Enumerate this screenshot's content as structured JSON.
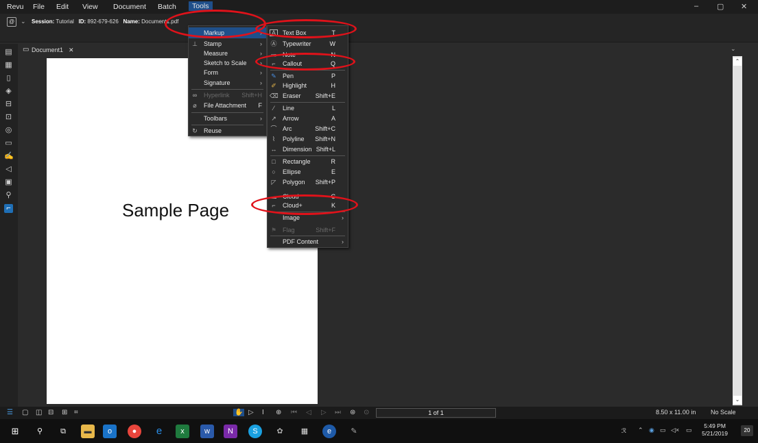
{
  "menubar": {
    "items": [
      "Revu",
      "File",
      "Edit",
      "View",
      "Document",
      "Batch",
      "Tools"
    ],
    "window_controls": [
      "–",
      "▢",
      "✕"
    ]
  },
  "session": {
    "label_session": "Session:",
    "session_value": "Tutorial",
    "label_id": "ID:",
    "id_value": "892-679-626",
    "label_name": "Name:",
    "name_value": "Document1.pdf"
  },
  "tab": {
    "label": "Document1",
    "close": "✕"
  },
  "page": {
    "text": "Sample Page"
  },
  "tools_menu": {
    "items": [
      {
        "label": "Markup",
        "shortcut": "",
        "arrow": "›",
        "state": "highlight"
      },
      {
        "label": "Stamp",
        "shortcut": "",
        "arrow": "›",
        "state": "normal"
      },
      {
        "label": "Measure",
        "shortcut": "",
        "arrow": "›",
        "state": "normal"
      },
      {
        "label": "Sketch to Scale",
        "shortcut": "",
        "arrow": "›",
        "state": "normal"
      },
      {
        "label": "Form",
        "shortcut": "",
        "arrow": "›",
        "state": "normal"
      },
      {
        "label": "Signature",
        "shortcut": "",
        "arrow": "›",
        "state": "normal"
      },
      {
        "label": "Hyperlink",
        "shortcut": "Shift+H",
        "arrow": "",
        "state": "disabled"
      },
      {
        "label": "File Attachment",
        "shortcut": "F",
        "arrow": "",
        "state": "normal"
      },
      {
        "label": "Toolbars",
        "shortcut": "",
        "arrow": "›",
        "state": "normal"
      },
      {
        "label": "Reuse",
        "shortcut": "",
        "arrow": "",
        "state": "normal"
      }
    ]
  },
  "markup_menu": {
    "items": [
      {
        "label": "Text Box",
        "shortcut": "T",
        "icon": "A"
      },
      {
        "label": "Typewriter",
        "shortcut": "W",
        "icon": "Ⓐ"
      },
      {
        "label": "Note",
        "shortcut": "N",
        "icon": "▭"
      },
      {
        "label": "Callout",
        "shortcut": "Q",
        "icon": "⌐"
      },
      {
        "label": "Pen",
        "shortcut": "P",
        "icon": "✎"
      },
      {
        "label": "Highlight",
        "shortcut": "H",
        "icon": "✐"
      },
      {
        "label": "Eraser",
        "shortcut": "Shift+E",
        "icon": "⌫"
      },
      {
        "label": "Line",
        "shortcut": "L",
        "icon": "⁄"
      },
      {
        "label": "Arrow",
        "shortcut": "A",
        "icon": "↗"
      },
      {
        "label": "Arc",
        "shortcut": "Shift+C",
        "icon": "⌒"
      },
      {
        "label": "Polyline",
        "shortcut": "Shift+N",
        "icon": "⌇"
      },
      {
        "label": "Dimension",
        "shortcut": "Shift+L",
        "icon": "↔"
      },
      {
        "label": "Rectangle",
        "shortcut": "R",
        "icon": "□"
      },
      {
        "label": "Ellipse",
        "shortcut": "E",
        "icon": "○"
      },
      {
        "label": "Polygon",
        "shortcut": "Shift+P",
        "icon": "◸"
      },
      {
        "label": "Cloud",
        "shortcut": "C",
        "icon": "☁"
      },
      {
        "label": "Cloud+",
        "shortcut": "K",
        "icon": "⌐"
      },
      {
        "label": "Image",
        "shortcut": "›",
        "icon": ""
      },
      {
        "label": "Flag",
        "shortcut": "Shift+F",
        "icon": "⚑"
      },
      {
        "label": "PDF Content",
        "shortcut": "›",
        "icon": ""
      }
    ]
  },
  "status": {
    "page_indicator": "1 of 1",
    "page_size": "8.50 x 11.00 in",
    "scale": "No Scale"
  },
  "clock": {
    "time": "5:49 PM",
    "date": "5/21/2019",
    "notif": "20"
  },
  "colors": {
    "accent": "#1f4f8a",
    "annotation": "#e0121a"
  }
}
